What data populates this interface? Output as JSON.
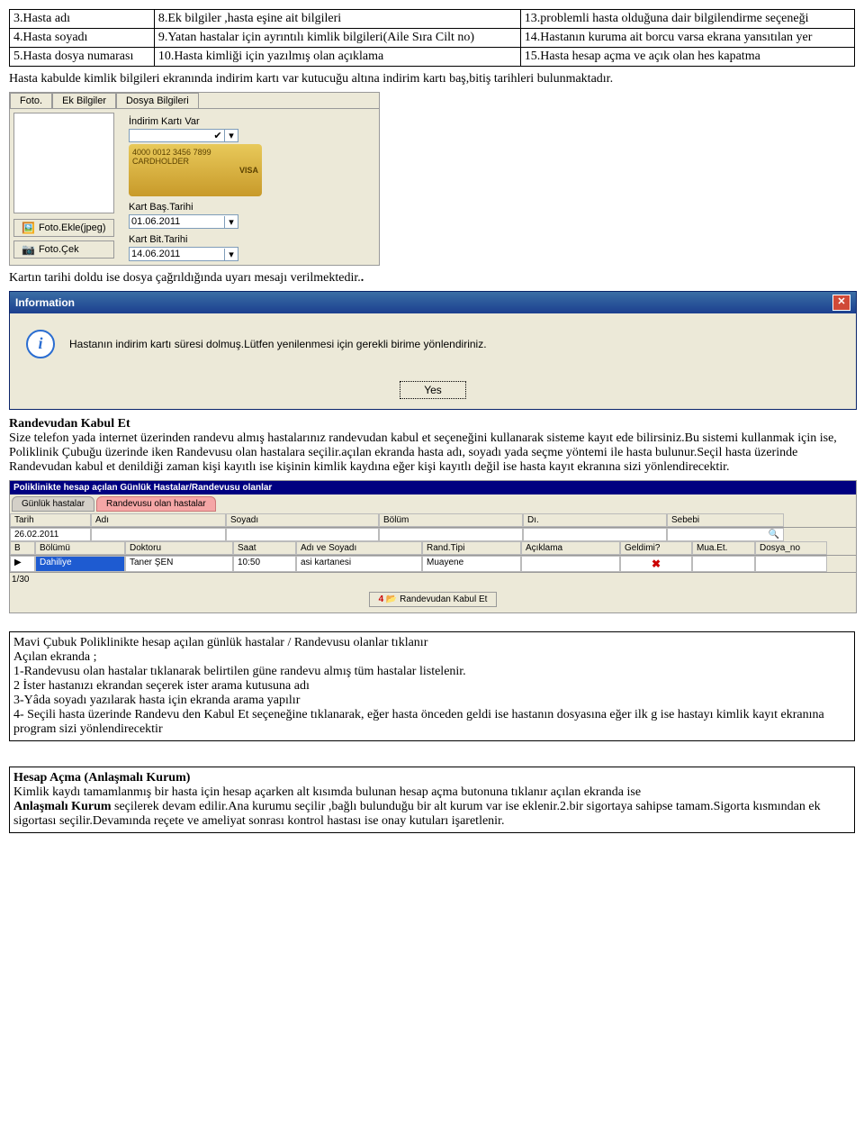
{
  "table": {
    "r1c1": "3.Hasta adı",
    "r1c2": "8.Ek bilgiler ,hasta eşine ait bilgileri",
    "r1c3": "13.problemli hasta olduğuna dair bilgilendirme seçeneği",
    "r2c1": "4.Hasta soyadı",
    "r2c2": "9.Yatan hastalar için ayrıntılı kimlik bilgileri(Aile Sıra Cilt no)",
    "r2c3": "14.Hastanın kuruma ait borcu varsa ekrana yansıtılan yer",
    "r3c1": "5.Hasta dosya numarası",
    "r3c2": "10.Hasta kimliği için  yazılmış  olan açıklama",
    "r3c3": "15.Hasta hesap açma ve açık olan hes kapatma"
  },
  "para1": "Hasta kabulde kimlik bilgileri ekranında indirim kartı var kutucuğu altına indirim kartı baş,bitiş tarihleri bulunmaktadır.",
  "shot1": {
    "tab1": "Foto.",
    "tab2": "Ek Bilgiler",
    "tab3": "Dosya Bilgileri",
    "btn_ekle": "Foto.Ekle(jpeg)",
    "btn_cek": "Foto.Çek",
    "lbl_ik": "İndirim Kartı Var",
    "cc_num": "4000 0012  3456  7899",
    "cc_name": "CARDHOLDER",
    "cc_visa": "VISA",
    "lbl_bas": "Kart Baş.Tarihi",
    "val_bas": "01.06.2011",
    "lbl_bit": "Kart Bit.Tarihi",
    "val_bit": "14.06.2011"
  },
  "para2": "Kartın tarihi doldu ise dosya çağrıldığında uyarı mesajı verilmektedir.",
  "dialog": {
    "title": "Information",
    "msg": "Hastanın indirim kartı süresi dolmuş.Lütfen yenilenmesi için gerekli birime yönlendiriniz.",
    "yes": "Yes"
  },
  "randevu": {
    "heading": "Randevudan Kabul Et",
    "body": "Size telefon yada internet üzerinden randevu almış hastalarınız randevudan kabul et seçeneğini kullanarak sisteme kayıt ede bilirsiniz.Bu sistemi kullanmak için  ise, Poliklinik Çubuğu üzerinde iken Randevusu olan hastalara seçilir.açılan ekranda hasta adı, soyadı  yada seçme yöntemi ile hasta bulunur.Seçil hasta üzerinde Randevudan kabul et denildiği zaman kişi kayıtlı ise kişinin kimlik kaydına eğer kişi kayıtlı değil ise hasta kayıt ekranına sizi yönlendirecektir."
  },
  "shot3": {
    "title": "Poliklinikte hesap açılan Günlük Hastalar/Randevusu olanlar",
    "tab1": "Günlük hastalar",
    "tab2": "Randevusu  olan hastalar",
    "h_tarih": "Tarih",
    "h_adi": "Adı",
    "h_soyadi": "Soyadı",
    "h_bolum": "Bölüm",
    "h_di": "Dı.",
    "h_sebebi": "Sebebi",
    "v_tarih": "26.02.2011",
    "h2_bolumu": "Bölümü",
    "h2_doktoru": "Doktoru",
    "h2_saat": "Saat",
    "h2_ad": "Adı ve Soyadı",
    "h2_tip": "Rand.Tipi",
    "h2_acik": "Açıklama",
    "h2_geldi": "Geldimi?",
    "h2_mua": "Mua.Et.",
    "h2_dosya": "Dosya_no",
    "v2_bolum": "Dahiliye",
    "v2_doktor": "Taner ŞEN",
    "v2_saat": "10:50",
    "v2_ad": "asi  kartanesi",
    "v2_tip": "Muayene",
    "pager": "1/30",
    "kabul": "Randevudan Kabul Et"
  },
  "mavi": {
    "l1": "Mavi Çubuk Poliklinikte hesap açılan günlük hastalar / Randevusu olanlar tıklanır",
    "l2": "Açılan ekranda ;",
    "l3": "1-Randevusu olan hastalar tıklanarak belirtilen güne randevu almış tüm hastalar listelenir.",
    "l4": "2 İster hastanızı ekrandan seçerek ister arama kutusuna adı",
    "l5": "3-Yâda soyadı yazılarak hasta için ekranda arama yapılır",
    "l6": "4- Seçili hasta üzerinde Randevu den Kabul Et seçeneğine tıklanarak, eğer hasta önceden geldi ise hastanın dosyasına eğer ilk g ise hastayı kimlik kayıt ekranına program sizi yönlendirecektir"
  },
  "hesap": {
    "h": "Hesap Açma (Anlaşmalı Kurum)",
    "l1": "Kimlik kaydı tamamlanmış bir hasta için hesap açarken alt kısımda bulunan hesap açma butonuna tıklanır açılan ekranda ise",
    "l2a": "Anlaşmalı Kurum",
    "l2b": " seçilerek devam edilir.Ana kurumu seçilir ,bağlı bulunduğu bir alt kurum var ise eklenir.2.bir sigortaya sahipse tamam.Sigorta kısmından ek sigortası seçilir.Devamında reçete ve ameliyat sonrası kontrol hastası ise onay kutuları işaretlenir."
  }
}
